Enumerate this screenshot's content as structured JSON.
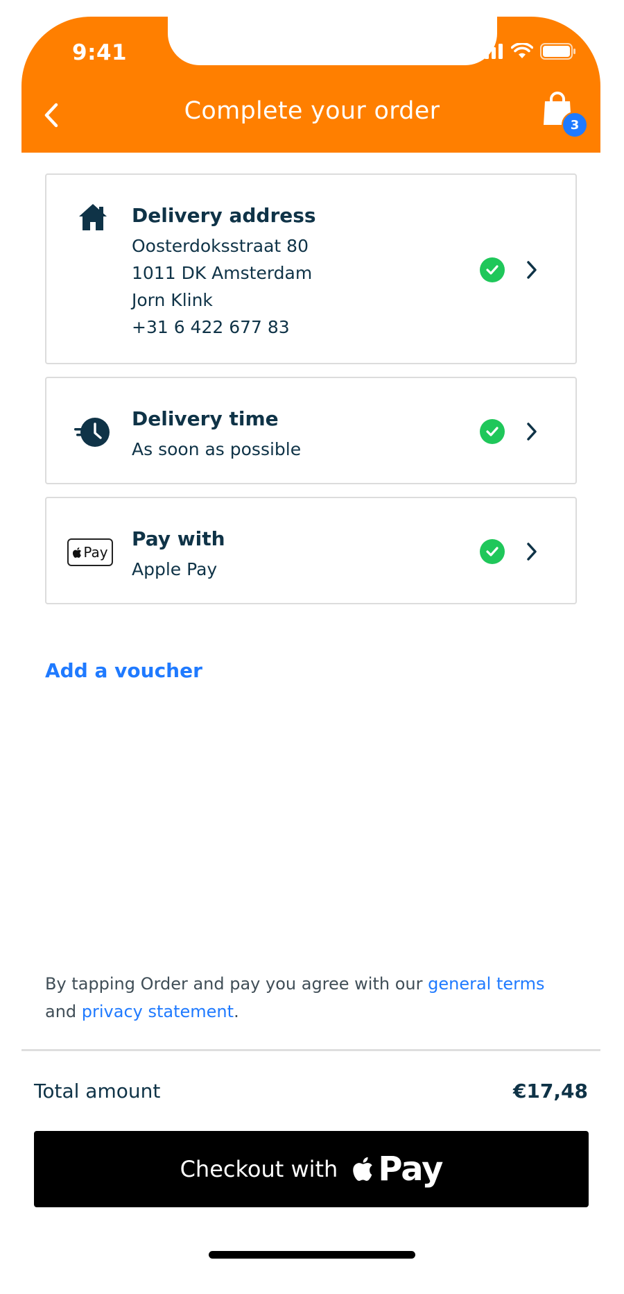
{
  "status_bar": {
    "time": "9:41"
  },
  "header": {
    "title": "Complete your order",
    "cart_count": "3"
  },
  "cards": {
    "delivery_address": {
      "title": "Delivery address",
      "lines": [
        "Oosterdoksstraat 80",
        "1011 DK Amsterdam",
        "Jorn Klink",
        "+31 6 422 677 83"
      ]
    },
    "delivery_time": {
      "title": "Delivery time",
      "value": "As soon as possible"
    },
    "payment": {
      "title": "Pay with",
      "value": "Apple Pay",
      "badge_label": "Pay"
    }
  },
  "voucher": {
    "label": "Add a voucher"
  },
  "terms": {
    "prefix": "By tapping Order and pay you agree with our ",
    "terms_link": "general terms",
    "middle": "and ",
    "privacy_link": "privacy statement",
    "suffix": "."
  },
  "total": {
    "label": "Total amount",
    "value": "€17,48"
  },
  "checkout": {
    "label": "Checkout with",
    "pay_word": "Pay"
  },
  "colors": {
    "brand": "#ff7f00",
    "link": "#1f7aff",
    "check": "#1fc75a",
    "text": "#0f3347"
  }
}
